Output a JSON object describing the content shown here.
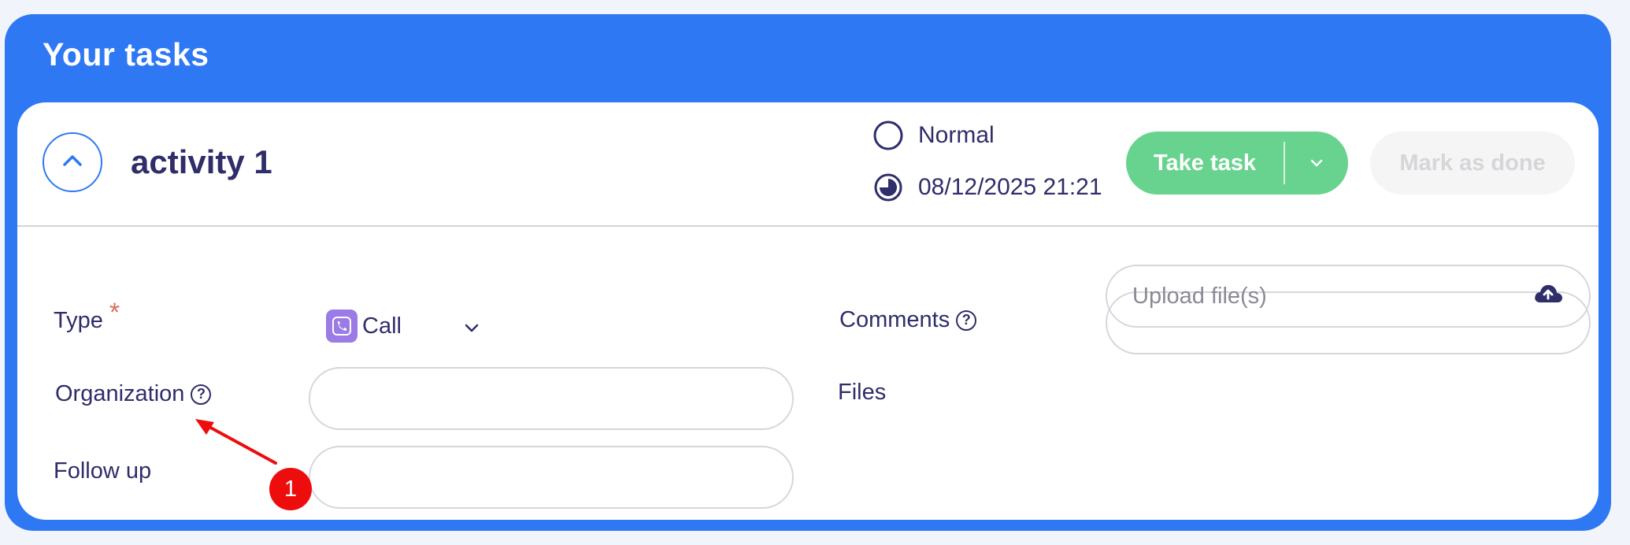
{
  "panel": {
    "title": "Your tasks"
  },
  "task": {
    "title": "activity 1",
    "priority": "Normal",
    "due": "08/12/2025 21:21",
    "take_task_label": "Take task",
    "mark_done_label": "Mark as done"
  },
  "form": {
    "type_label": "Type",
    "required_mark": "*",
    "type_value": "Call",
    "organization_label": "Organization",
    "organization_value": "",
    "follow_up_label": "Follow up",
    "follow_up_value": "",
    "comments_label": "Comments",
    "comments_value": "",
    "files_label": "Files",
    "upload_placeholder": "Upload file(s)",
    "help_glyph": "?"
  },
  "annotation": {
    "badge": "1",
    "color": "#ee0d0d"
  },
  "colors": {
    "accent": "#2f78f4",
    "take_task": "#68d38e",
    "text": "#2f2d6a",
    "call_badge": "#9b7be6"
  }
}
